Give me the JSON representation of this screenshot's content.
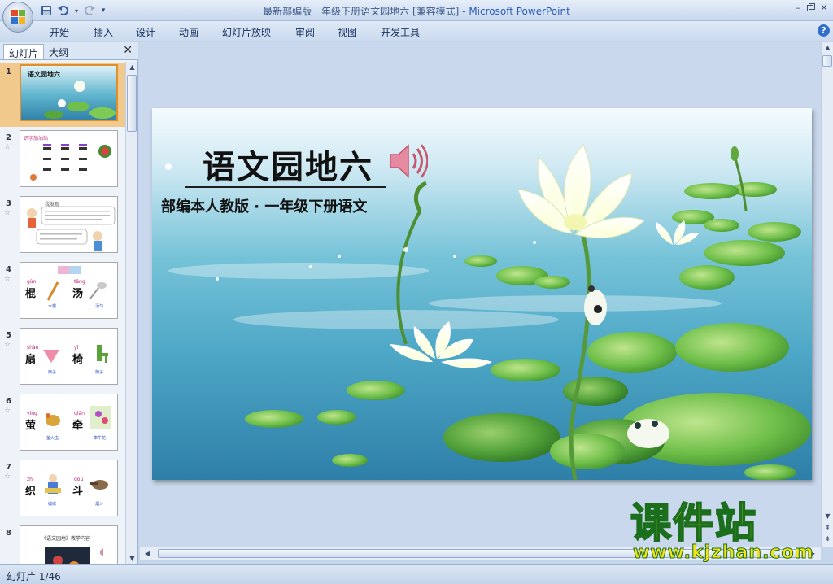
{
  "window": {
    "title": "最新部编版一年级下册语文园地六 [兼容模式]",
    "title_separator": " - ",
    "app_name": "Microsoft PowerPoint"
  },
  "ribbon": {
    "tabs": [
      "开始",
      "插入",
      "设计",
      "动画",
      "幻灯片放映",
      "审阅",
      "视图",
      "开发工具"
    ]
  },
  "panel": {
    "tabs": [
      "幻灯片",
      "大纲"
    ],
    "active_tab": "幻灯片"
  },
  "thumbnails": [
    {
      "number": "1",
      "label": "语文园地六",
      "selected": true
    },
    {
      "number": "2",
      "label": "识字加油站"
    },
    {
      "number": "3",
      "label": "我发现"
    },
    {
      "number": "4",
      "words": [
        "棍",
        "汤"
      ],
      "pinyin": [
        "gùn",
        "tāng"
      ],
      "captions": [
        "木棍",
        "汤勺"
      ]
    },
    {
      "number": "5",
      "words": [
        "扇",
        "椅"
      ],
      "pinyin": [
        "shàn",
        "yǐ"
      ],
      "captions": [
        "扇子",
        "椅子"
      ]
    },
    {
      "number": "6",
      "words": [
        "萤",
        "牵"
      ],
      "pinyin": [
        "yíng",
        "qiān"
      ],
      "captions": [
        "萤火虫",
        "牵牛花"
      ]
    },
    {
      "number": "7",
      "words": [
        "织",
        "斗"
      ],
      "pinyin": [
        "zhī",
        "dǒu"
      ],
      "captions": [
        "编织",
        "烟斗"
      ]
    },
    {
      "number": "8",
      "label": "《语文园地》教学内容"
    }
  ],
  "slide": {
    "title": "语文园地六",
    "subtitle": "部编本人教版 · 一年级下册语文"
  },
  "status": {
    "slide_counter": "幻灯片 1/46"
  },
  "watermark": {
    "name": "课件站",
    "url": "www.kjzhan.com"
  },
  "colors": {
    "water_top": "#cfe9f3",
    "water_mid": "#5fb6cf",
    "water_deep": "#2e7fa8",
    "lily_pad": "#6fbf4a",
    "selection": "#e08f2b",
    "watermark_fill": "#f3e419",
    "watermark_stroke": "#1b6e1b"
  },
  "icons": [
    "office-button-icon",
    "save-icon",
    "undo-icon",
    "redo-icon",
    "qat-customize-icon",
    "minimize-icon",
    "restore-icon",
    "close-icon",
    "help-icon",
    "speaker-icon"
  ]
}
